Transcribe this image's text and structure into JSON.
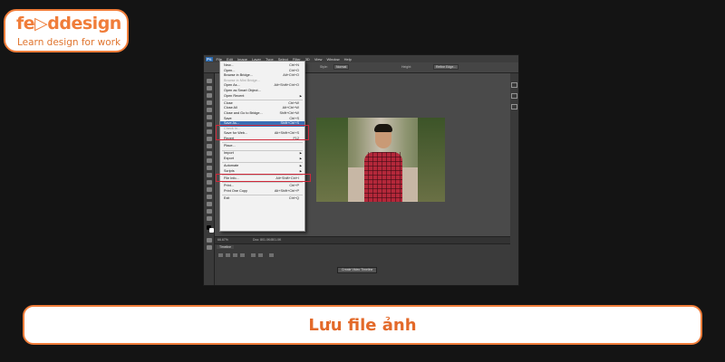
{
  "brand": {
    "name_part1": "fe",
    "name_part2": "d",
    "name_part3": "design",
    "tagline": "Learn design for work",
    "color": "#f07d3a"
  },
  "photoshop": {
    "app_icon": "Ps",
    "menubar": [
      "File",
      "Edit",
      "Image",
      "Layer",
      "Type",
      "Select",
      "Filter",
      "3D",
      "View",
      "Window",
      "Help"
    ],
    "options": {
      "style_label": "Style:",
      "style_value": "Normal",
      "height_label": "Height:",
      "refine_label": "Refine Edge..."
    },
    "status": {
      "zoom": "66.67%",
      "doc": "Doc: 801.0K/801.0K"
    },
    "timeline": {
      "tab": "Timeline",
      "create_button": "Create Video Timeline"
    },
    "file_menu": [
      {
        "label": "New...",
        "shortcut": "Ctrl+N"
      },
      {
        "label": "Open...",
        "shortcut": "Ctrl+O"
      },
      {
        "label": "Browse in Bridge...",
        "shortcut": "Alt+Ctrl+O"
      },
      {
        "label": "Browse in Mini Bridge...",
        "shortcut": "",
        "disabled": true
      },
      {
        "label": "Open As...",
        "shortcut": "Alt+Shift+Ctrl+O"
      },
      {
        "label": "Open as Smart Object...",
        "shortcut": ""
      },
      {
        "label": "Open Recent",
        "shortcut": "",
        "submenu": true
      },
      {
        "sep": true
      },
      {
        "label": "Close",
        "shortcut": "Ctrl+W"
      },
      {
        "label": "Close All",
        "shortcut": "Alt+Ctrl+W"
      },
      {
        "label": "Close and Go to Bridge...",
        "shortcut": "Shift+Ctrl+W"
      },
      {
        "label": "Save",
        "shortcut": "Ctrl+S"
      },
      {
        "label": "Save As...",
        "shortcut": "Shift+Ctrl+S",
        "selected": true
      },
      {
        "label": "Check In...",
        "shortcut": "",
        "disabled": true
      },
      {
        "label": "Save for Web...",
        "shortcut": "Alt+Shift+Ctrl+S"
      },
      {
        "label": "Revert",
        "shortcut": "F12"
      },
      {
        "sep": true
      },
      {
        "label": "Place...",
        "shortcut": ""
      },
      {
        "sep": true
      },
      {
        "label": "Import",
        "shortcut": "",
        "submenu": true
      },
      {
        "label": "Export",
        "shortcut": "",
        "submenu": true
      },
      {
        "sep": true
      },
      {
        "label": "Automate",
        "shortcut": "",
        "submenu": true
      },
      {
        "label": "Scripts",
        "shortcut": "",
        "submenu": true
      },
      {
        "sep": true
      },
      {
        "label": "File Info...",
        "shortcut": "Alt+Shift+Ctrl+I"
      },
      {
        "sep": true
      },
      {
        "label": "Print...",
        "shortcut": "Ctrl+P"
      },
      {
        "label": "Print One Copy",
        "shortcut": "Alt+Shift+Ctrl+P"
      },
      {
        "sep": true
      },
      {
        "label": "Exit",
        "shortcut": "Ctrl+Q"
      }
    ]
  },
  "caption": "Lưu file ảnh"
}
